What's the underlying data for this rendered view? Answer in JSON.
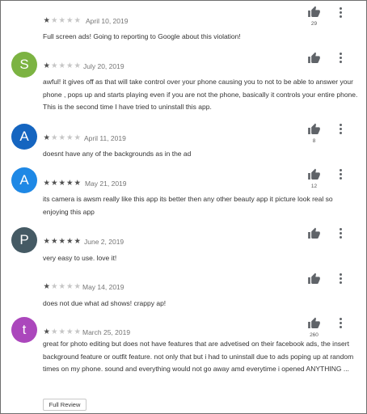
{
  "colors": {
    "star_filled": "#505050",
    "star_empty": "#c6c6c6"
  },
  "reviews": [
    {
      "initial": "",
      "avatar_color": "",
      "stars": 1,
      "date": "April 10, 2019",
      "text": "Full screen ads! Going to reporting to Google about this violation!",
      "likes": "29"
    },
    {
      "initial": "S",
      "avatar_color": "#7cb342",
      "stars": 1,
      "date": "July 20, 2019",
      "text": "awful! it gives off as that will take control over your phone causing you to not to be able to answer your phone , pops up and starts playing even if you are not the phone, basically it controls your entire phone. This is the second time I have tried to uninstall this app.",
      "likes": ""
    },
    {
      "initial": "A",
      "avatar_color": "#1565c0",
      "stars": 1,
      "date": "April 11, 2019",
      "text": "doesnt have any of the backgrounds as in the ad",
      "likes": "8"
    },
    {
      "initial": "A",
      "avatar_color": "#1e88e5",
      "stars": 5,
      "date": "May 21, 2019",
      "text": "its camera is awsm really like this app its better then any other beauty app it picture look real so enjoying this app",
      "likes": "12"
    },
    {
      "initial": "P",
      "avatar_color": "#455a64",
      "stars": 5,
      "date": "June 2, 2019",
      "text": "very easy to use. love it!",
      "likes": ""
    },
    {
      "initial": "",
      "avatar_color": "",
      "stars": 1,
      "date": "May 14, 2019",
      "text": "does not due what ad shows! crappy ap!",
      "likes": ""
    },
    {
      "initial": "t",
      "avatar_color": "#ab47bc",
      "stars": 1,
      "date": "March 25, 2019",
      "text": "great for photo editing but does not have features that are advetised on their facebook ads, the insert background feature or outfit feature. not only that but i had to uninstall due to ads poping up at random times on my phone. sound and everything would not go away amd everytime i opened ANYTHING ...",
      "likes": "260",
      "full_review_label": "Full Review"
    }
  ]
}
